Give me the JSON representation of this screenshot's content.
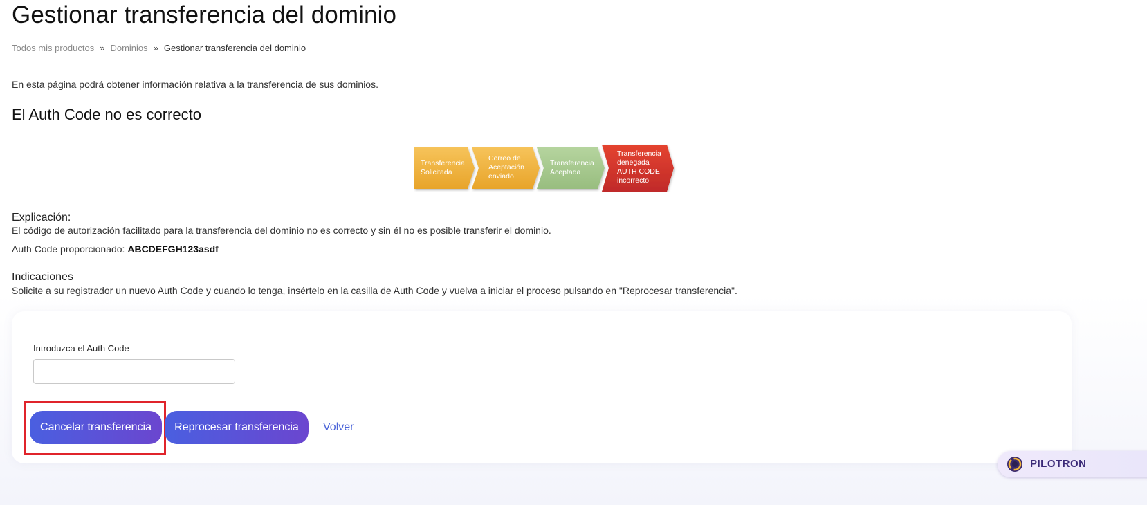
{
  "page": {
    "title": "Gestionar transferencia del dominio",
    "intro": "En esta página podrá obtener información relativa a la transferencia de sus dominios.",
    "status_heading": "El Auth Code no es correcto"
  },
  "breadcrumb": {
    "items": [
      "Todos mis productos",
      "Dominios",
      "Gestionar transferencia del dominio"
    ],
    "separator": "»"
  },
  "steps": [
    {
      "lines": [
        "Transferencia",
        "Solicitada"
      ],
      "color": "#f0b43a"
    },
    {
      "lines": [
        "Correo de",
        "Aceptación",
        "enviado"
      ],
      "color": "#f0b43a"
    },
    {
      "lines": [
        "Transferencia",
        "Aceptada"
      ],
      "color": "#a8c98f"
    },
    {
      "lines": [
        "Transferencia",
        "denegada",
        "AUTH CODE",
        "incorrecto"
      ],
      "color": "#d5342b"
    }
  ],
  "explanation": {
    "title": "Explicación:",
    "text": "El código de autorización facilitado para la transferencia del dominio no es correcto y sin él no es posible transferir el dominio.",
    "auth_code_label": "Auth Code proporcionado:",
    "auth_code_value": "ABCDEFGH123asdf"
  },
  "indications": {
    "title": "Indicaciones",
    "text": "Solicite a su registrador un nuevo Auth Code y cuando lo tenga, insértelo en la casilla de Auth Code y vuelva a iniciar el proceso pulsando en \"Reprocesar transferencia\"."
  },
  "form": {
    "auth_code_label": "Introduzca el Auth Code",
    "auth_code_value": "",
    "cancel_button": "Cancelar transferencia",
    "reprocess_button": "Reprocesar transferencia",
    "back_link": "Volver"
  },
  "badge": {
    "text": "PILOTRON"
  },
  "colors": {
    "button_start": "#4a5fe0",
    "button_end": "#6b46cf",
    "highlight": "#e0242b",
    "link": "#4a63d8"
  }
}
